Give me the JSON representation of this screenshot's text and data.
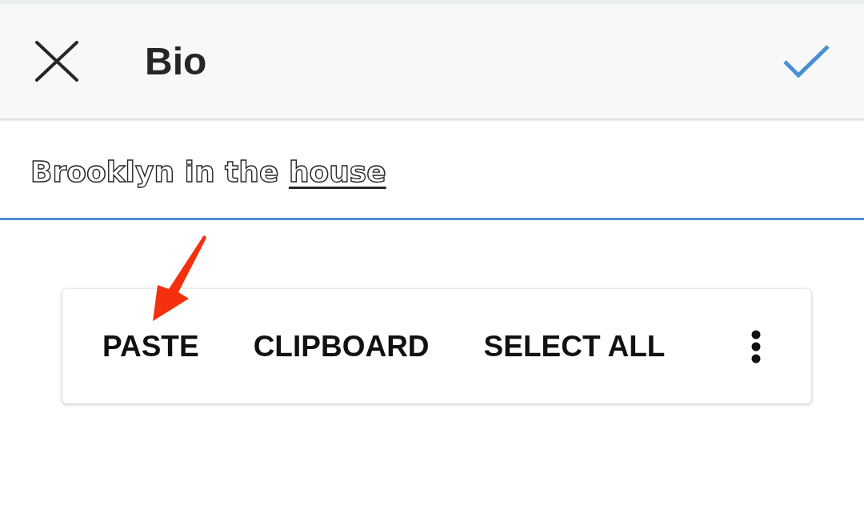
{
  "app_bar": {
    "title": "Bio"
  },
  "bio_field": {
    "focused": true,
    "segments": [
      {
        "text": "Brooklyn in the",
        "underlined": false
      },
      {
        "text": "house",
        "underlined": true
      }
    ]
  },
  "text_selection_menu": {
    "items": [
      "PASTE",
      "CLIPBOARD",
      "SELECT ALL"
    ]
  }
}
